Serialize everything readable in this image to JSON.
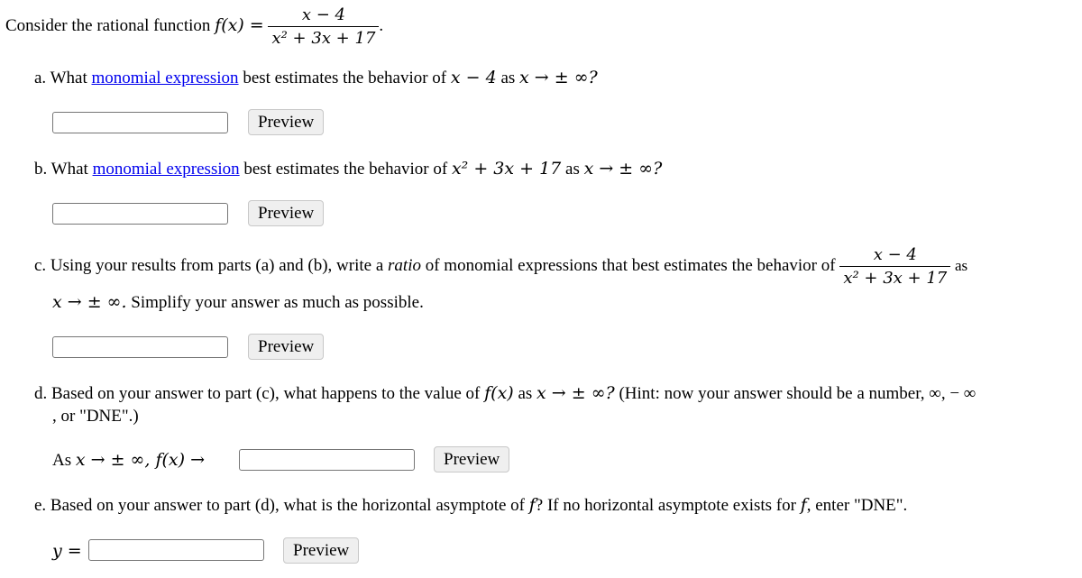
{
  "intro": {
    "prefix": "Consider the rational function ",
    "func": "f(x) =",
    "numerator": "x − 4",
    "denominator": "x² + 3x + 17",
    "suffix": "."
  },
  "parts": {
    "a": {
      "label": "a. What ",
      "link": "monomial expression",
      "text": " best estimates the behavior of ",
      "expr": "x − 4",
      "tail": " as ",
      "limit": "x → ± ∞?",
      "input_value": "",
      "preview": "Preview"
    },
    "b": {
      "label": "b. What ",
      "link": "monomial expression",
      "text": " best estimates the behavior of ",
      "expr": "x² + 3x + 17",
      "tail": " as ",
      "limit": "x → ± ∞?",
      "input_value": "",
      "preview": "Preview"
    },
    "c": {
      "text1": "c. Using your results from parts (a) and (b), write a ",
      "ratio": "ratio",
      "text2": " of monomial expressions that best estimates the behavior of ",
      "numerator": "x − 4",
      "denominator": "x² + 3x + 17",
      "as": "as",
      "line2_math": "x → ± ∞.",
      "line2_text": " Simplify your answer as much as possible.",
      "input_value": "",
      "preview": "Preview"
    },
    "d": {
      "text1": "d. Based on your answer to part (c), what happens to the value of ",
      "fx": "f(x)",
      "text2": " as ",
      "limit": "x → ± ∞?",
      "hint": " (Hint: now your answer should be a number, ∞, − ∞",
      "line2": ", or \"DNE\".)",
      "answer_prefix": "As ",
      "answer_math": "x → ± ∞, f(x) →",
      "input_value": "",
      "preview": "Preview"
    },
    "e": {
      "text1": "e. Based on your answer to part (d), what is the horizontal asymptote of ",
      "f1": "f",
      "text2": "? If no horizontal asymptote exists for ",
      "f2": "f",
      "text3": ", enter \"DNE\".",
      "answer_label": "y =",
      "input_value": "",
      "preview": "Preview"
    }
  }
}
